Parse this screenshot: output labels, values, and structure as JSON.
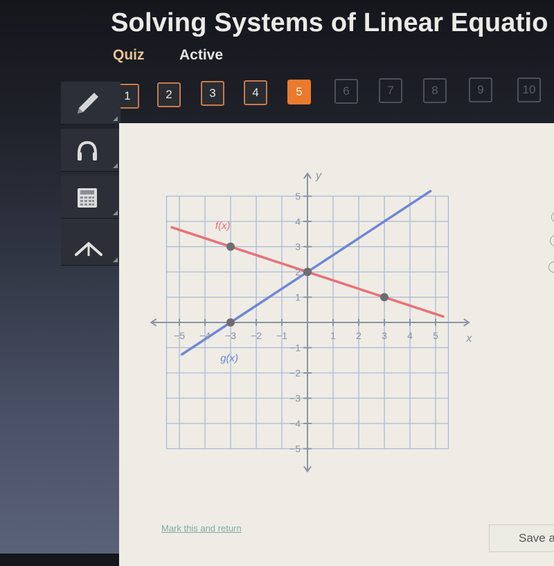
{
  "header": {
    "title": "Solving Systems of Linear Equatio",
    "tabs": [
      {
        "label": "Quiz",
        "active": true
      },
      {
        "label": "Active",
        "active": false
      }
    ]
  },
  "question_nav": {
    "current": 5,
    "items": [
      {
        "label": "1",
        "state": "visited"
      },
      {
        "label": "2",
        "state": "visited"
      },
      {
        "label": "3",
        "state": "visited"
      },
      {
        "label": "4",
        "state": "visited"
      },
      {
        "label": "5",
        "state": "current"
      },
      {
        "label": "6",
        "state": "disabled"
      },
      {
        "label": "7",
        "state": "disabled"
      },
      {
        "label": "8",
        "state": "disabled"
      },
      {
        "label": "9",
        "state": "disabled"
      },
      {
        "label": "10",
        "state": "disabled"
      }
    ]
  },
  "toolbar": {
    "tools": [
      {
        "name": "pencil-icon",
        "label": "Pencil"
      },
      {
        "name": "headphones-icon",
        "label": "Audio"
      },
      {
        "name": "calculator-icon",
        "label": "Calculator"
      },
      {
        "name": "reference-icon",
        "label": "Reference"
      }
    ]
  },
  "chart_data": {
    "type": "line",
    "title": "",
    "xlabel": "x",
    "ylabel": "y",
    "xlim": [
      -5.5,
      5.5
    ],
    "ylim": [
      -5,
      5
    ],
    "grid": true,
    "x_ticks": [
      -5,
      -4,
      -3,
      -2,
      -1,
      1,
      2,
      3,
      4,
      5
    ],
    "y_ticks": [
      -5,
      -4,
      -3,
      -2,
      -1,
      1,
      2,
      3,
      4,
      5
    ],
    "series": [
      {
        "name": "f(x)",
        "color": "#e8707a",
        "slope": -0.3333,
        "intercept": 2,
        "x_range": [
          -5.3,
          5.3
        ],
        "points": [
          [
            -3,
            3
          ],
          [
            0,
            2
          ],
          [
            3,
            1
          ]
        ],
        "label_at": [
          -3.6,
          3.7
        ]
      },
      {
        "name": "g(x)",
        "color": "#6f86d6",
        "slope": 0.6667,
        "intercept": 2,
        "x_range": [
          -4.9,
          4.8
        ],
        "points": [
          [
            -3,
            0
          ],
          [
            0,
            2
          ]
        ],
        "label_at": [
          -3.4,
          -1.55
        ]
      }
    ],
    "point_color": "#6e6e72"
  },
  "answer_options": {
    "count": 3
  },
  "footer": {
    "mark_link": "Mark this and return",
    "save_button": "Save a"
  }
}
